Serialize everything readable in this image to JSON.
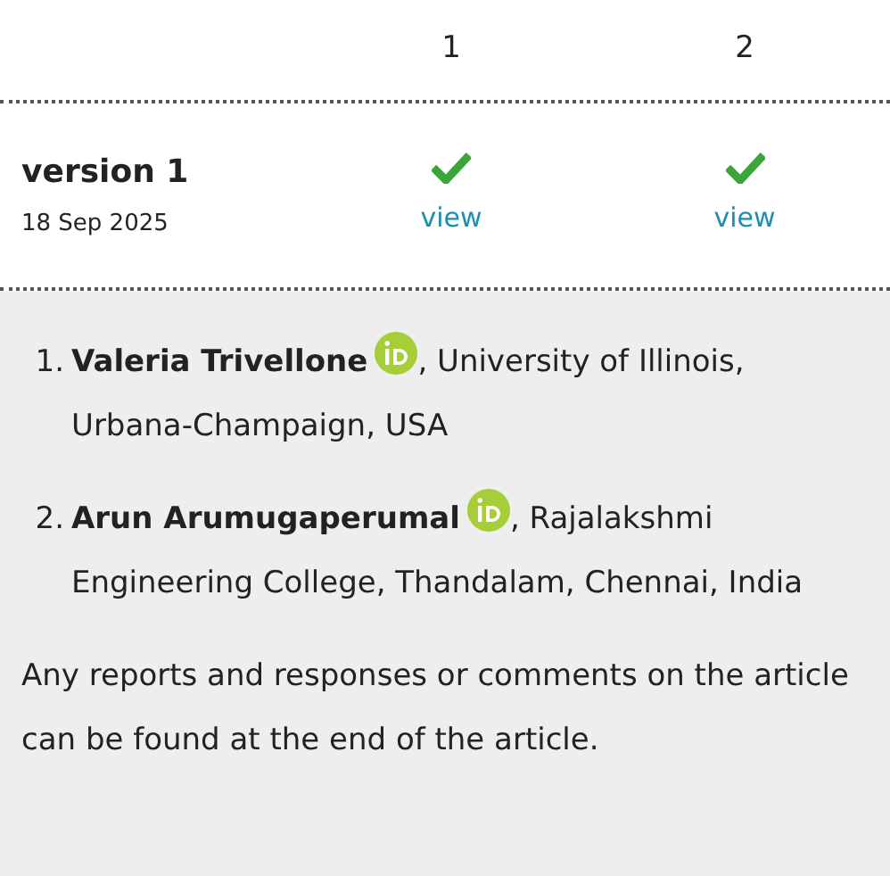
{
  "columns": [
    "1",
    "2"
  ],
  "versions": [
    {
      "label": "version 1",
      "date": "18 Sep 2025",
      "reports": [
        {
          "approved": true,
          "link": "view"
        },
        {
          "approved": true,
          "link": "view"
        }
      ]
    }
  ],
  "authors": [
    {
      "number": "1.",
      "name": "Valeria Trivellone",
      "orcid": true,
      "affiliation": ", University of Illinois, Urbana-Champaign, USA"
    },
    {
      "number": "2.",
      "name": "Arun Arumugaperumal",
      "orcid": true,
      "affiliation": ", Rajalakshmi Engineering College, Thandalam, Chennai, India"
    }
  ],
  "note": "Any reports and responses or comments on the article can be found at the end of the article."
}
